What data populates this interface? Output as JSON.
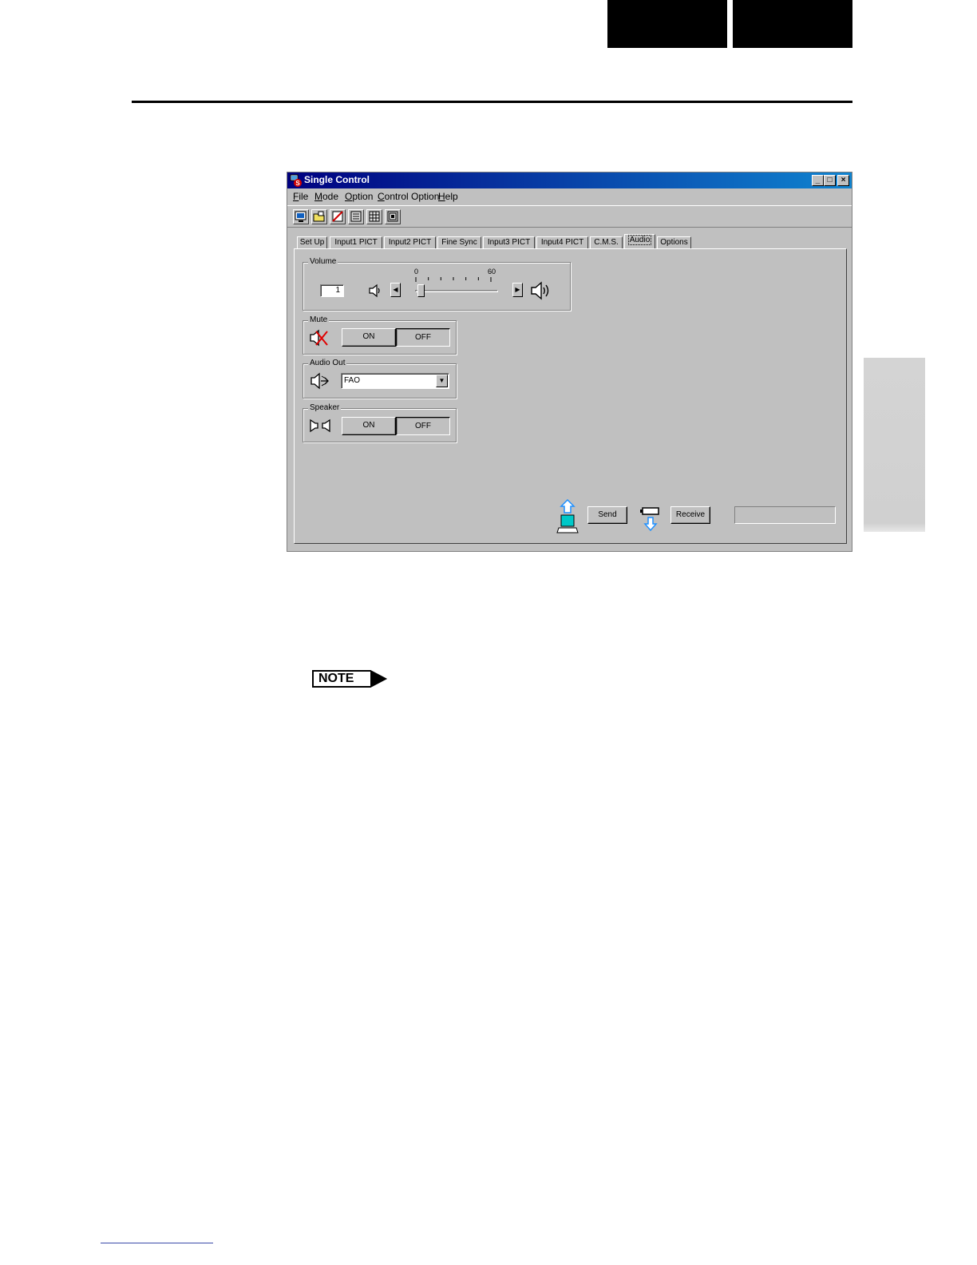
{
  "window": {
    "title": "Single Control",
    "controls": {
      "minimize": "_",
      "maximize": "□",
      "close": "×"
    }
  },
  "menu": [
    {
      "label": "File",
      "accel": "F",
      "rest": "ile"
    },
    {
      "label": "Mode",
      "accel": "M",
      "rest": "ode"
    },
    {
      "label": "Option",
      "accel": "O",
      "rest": "ption"
    },
    {
      "label": "Control Option",
      "accel": "C",
      "rest": "ontrol Option"
    },
    {
      "label": "Help",
      "accel": "H",
      "rest": "elp"
    }
  ],
  "toolbar_icons": [
    "monitor-icon",
    "open-folder-icon",
    "cancel-icon",
    "list-icon",
    "grid-icon",
    "multi-window-icon"
  ],
  "tabs": [
    {
      "label": "Set Up"
    },
    {
      "label": "Input1 PICT"
    },
    {
      "label": "Input2 PICT"
    },
    {
      "label": "Fine Sync"
    },
    {
      "label": "Input3 PICT"
    },
    {
      "label": "Input4 PICT"
    },
    {
      "label": "C.M.S."
    },
    {
      "label": "Audio",
      "active": true
    },
    {
      "label": "Options"
    }
  ],
  "volume": {
    "legend": "Volume",
    "value": "1",
    "min_label": "0",
    "max_label": "60",
    "level": 1,
    "max": 60
  },
  "mute": {
    "legend": "Mute",
    "on_label": "ON",
    "off_label": "OFF",
    "selected": "OFF"
  },
  "audio_out": {
    "legend": "Audio Out",
    "value": "FAO"
  },
  "speaker": {
    "legend": "Speaker",
    "on_label": "ON",
    "off_label": "OFF",
    "selected": "OFF"
  },
  "actions": {
    "send_label": "Send",
    "receive_label": "Receive",
    "status": ""
  },
  "note": {
    "label": "NOTE"
  },
  "colors": {
    "face": "#c0c0c0",
    "title_start": "#000080",
    "title_end": "#1084d0",
    "mute_x": "#e00000",
    "arrow": "#1e90ff",
    "screen": "#00c8c8"
  }
}
